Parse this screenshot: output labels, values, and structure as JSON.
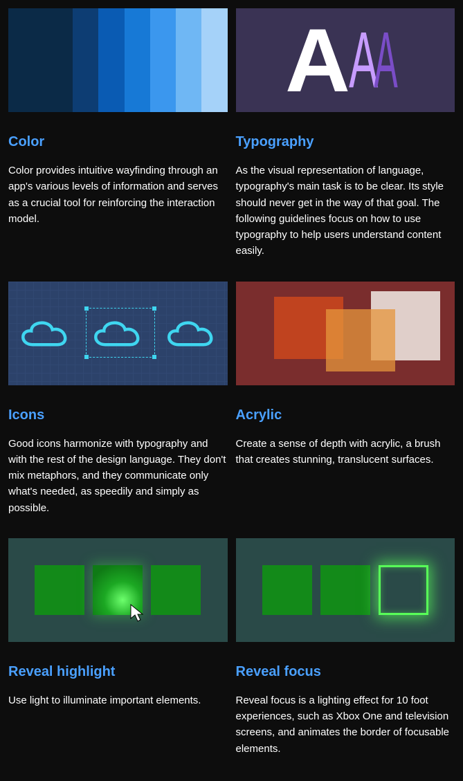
{
  "cards": [
    {
      "title": "Color",
      "description": "Color provides intuitive wayfinding through an app's various levels of information and serves as a crucial tool for reinforcing the interaction model."
    },
    {
      "title": "Typography",
      "description": "As the visual representation of language, typography's main task is to be clear. Its style should never get in the way of that goal. The following guidelines focus on how to use typography to help users understand content easily."
    },
    {
      "title": "Icons",
      "description": "Good icons harmonize with typography and with the rest of the design language. They don't mix metaphors, and they communicate only what's needed, as speedily and simply as possible."
    },
    {
      "title": "Acrylic",
      "description": "Create a sense of depth with acrylic, a brush that creates stunning, translucent surfaces."
    },
    {
      "title": "Reveal highlight",
      "description": "Use light to illuminate important elements."
    },
    {
      "title": "Reveal focus",
      "description": "Reveal focus is a lighting effect for 10 foot experiences, such as Xbox One and television screens, and animates the border of focusable elements."
    }
  ]
}
